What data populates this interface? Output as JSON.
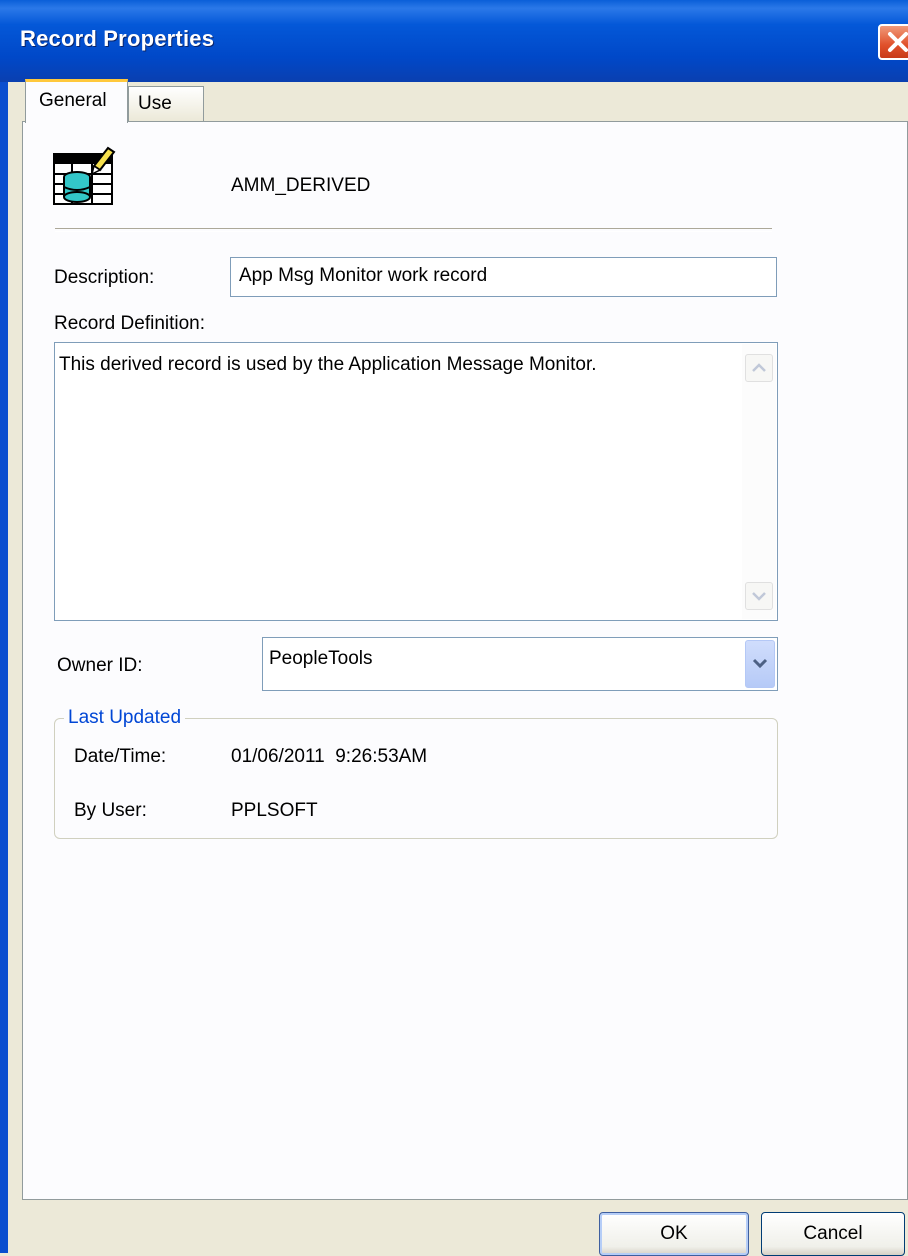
{
  "window": {
    "title": "Record Properties"
  },
  "tabs": [
    {
      "label": "General"
    },
    {
      "label": "Use"
    }
  ],
  "record": {
    "name": "AMM_DERIVED",
    "icon": "record-table-edit-icon"
  },
  "fields": {
    "description_label": "Description:",
    "description_value": "App Msg Monitor work record",
    "record_definition_label": "Record Definition:",
    "record_definition_value": "This derived record is used by the Application  Message Monitor.",
    "owner_id_label": "Owner ID:",
    "owner_id_value": "PeopleTools"
  },
  "last_updated": {
    "title": "Last Updated",
    "datetime_label": "Date/Time:",
    "datetime_value": "01/06/2011  9:26:53AM",
    "by_user_label": "By User:",
    "by_user_value": "PPLSOFT"
  },
  "buttons": {
    "ok_label": "OK",
    "cancel_label": "Cancel"
  },
  "colors": {
    "titlebar": "#0054e3",
    "group_title": "#0046d5",
    "tab_highlight": "#ffc83c"
  }
}
